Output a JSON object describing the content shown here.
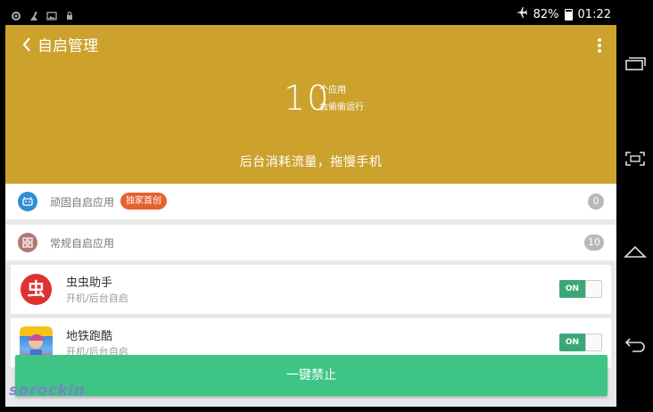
{
  "status_bar": {
    "battery": "82%",
    "time": "01:22"
  },
  "header": {
    "title": "自启管理",
    "count": "10",
    "count_line1": "个应用",
    "count_line2": "会偷偷运行",
    "message": "后台消耗流量，拖慢手机"
  },
  "categories": [
    {
      "label": "顽固自启应用",
      "badge": "独家首创",
      "count": "0",
      "color": "#2f8fd6"
    },
    {
      "label": "常规自启应用",
      "count": "10",
      "color": "#b07a73"
    }
  ],
  "apps": [
    {
      "name": "虫虫助手",
      "desc": "开机/后台自启",
      "toggle_label": "ON",
      "icon": "chongchong-app-icon",
      "icon_glyph": "虫"
    },
    {
      "name": "地铁跑酷",
      "desc": "开机/后台自启",
      "toggle_label": "ON",
      "icon": "subway-surfers-app-icon"
    }
  ],
  "action_button": {
    "label": "一键禁止"
  },
  "watermark": "sorockin",
  "colors": {
    "header": "#cca22d",
    "toggle_on": "#3aa876",
    "action": "#3ec585",
    "badge": "#e8602c"
  }
}
